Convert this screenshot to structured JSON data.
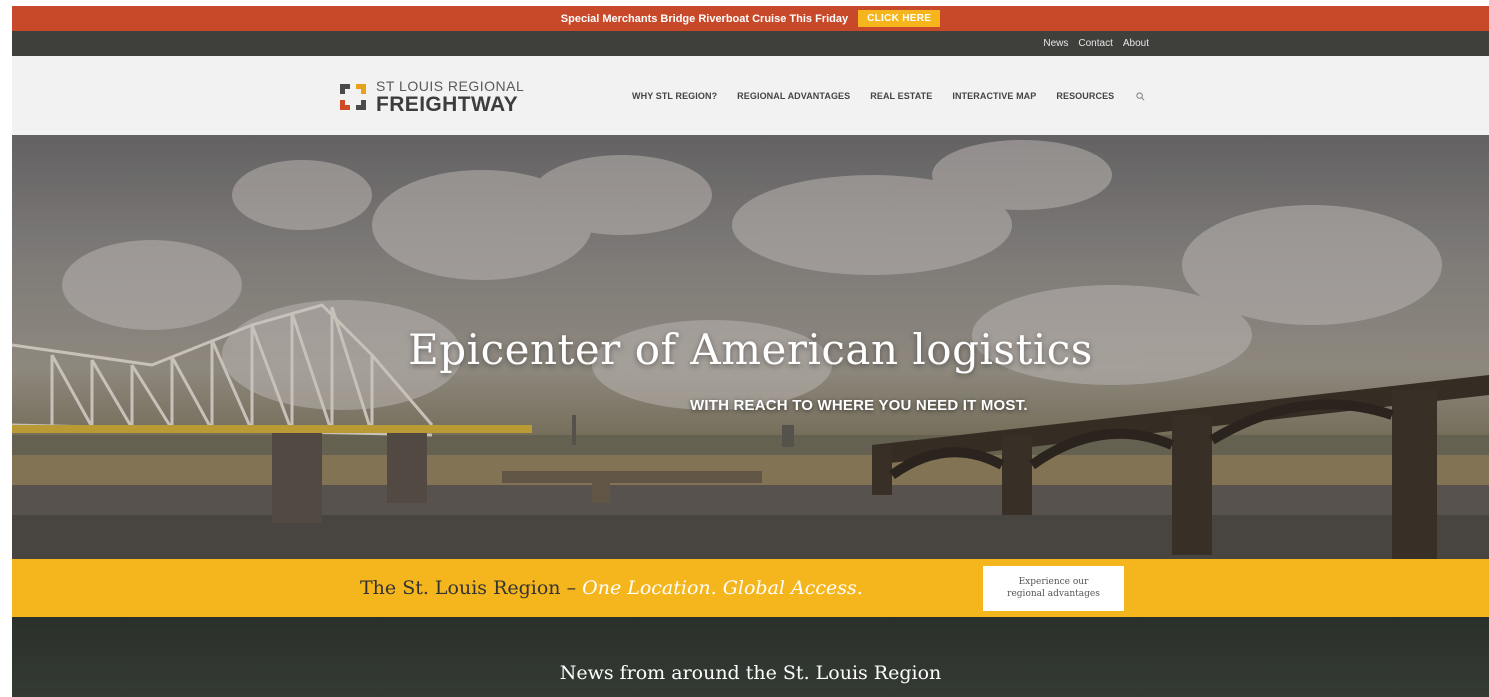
{
  "promo": {
    "text": "Special Merchants Bridge Riverboat Cruise This Friday",
    "button_label": "CLICK HERE"
  },
  "utility": {
    "links": [
      "News",
      "Contact",
      "About"
    ]
  },
  "header": {
    "logo_line1": "ST LOUIS REGIONAL",
    "logo_line2": "FREIGHTWAY",
    "nav": [
      "WHY STL REGION?",
      "REGIONAL ADVANTAGES",
      "REAL ESTATE",
      "INTERACTIVE MAP",
      "RESOURCES"
    ],
    "search_icon": "search-icon"
  },
  "hero": {
    "title": "Epicenter of American logistics",
    "subtitle": "WITH REACH TO WHERE YOU NEED IT MOST."
  },
  "band": {
    "text": "The St. Louis Region –",
    "text_italic": "One Location. Global Access.",
    "button_line1": "Experience our",
    "button_line2": "regional advantages"
  },
  "news": {
    "title": "News from around the St. Louis Region"
  },
  "colors": {
    "promo_bar": "#c8482a",
    "accent_yellow": "#f5b51c",
    "utility_bar": "#3f403c",
    "header_bg": "#f2f2f2"
  }
}
